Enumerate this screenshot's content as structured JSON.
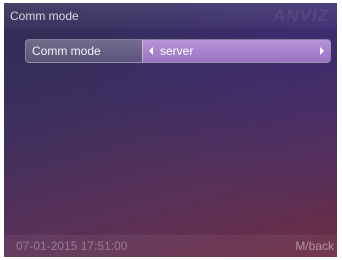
{
  "header": {
    "title": "Comm mode",
    "brand": "ANVIZ"
  },
  "setting": {
    "label": "Comm mode",
    "value": "server",
    "left_icon": "arrow-left-icon",
    "right_icon": "arrow-right-icon"
  },
  "status_bar": {
    "datetime": "07-01-2015 17:51:00",
    "back_hint": "M/back"
  },
  "colors": {
    "selector_fill": "#a981cc",
    "background_top": "#2f2c55",
    "background_bottom": "#6b2c44"
  }
}
